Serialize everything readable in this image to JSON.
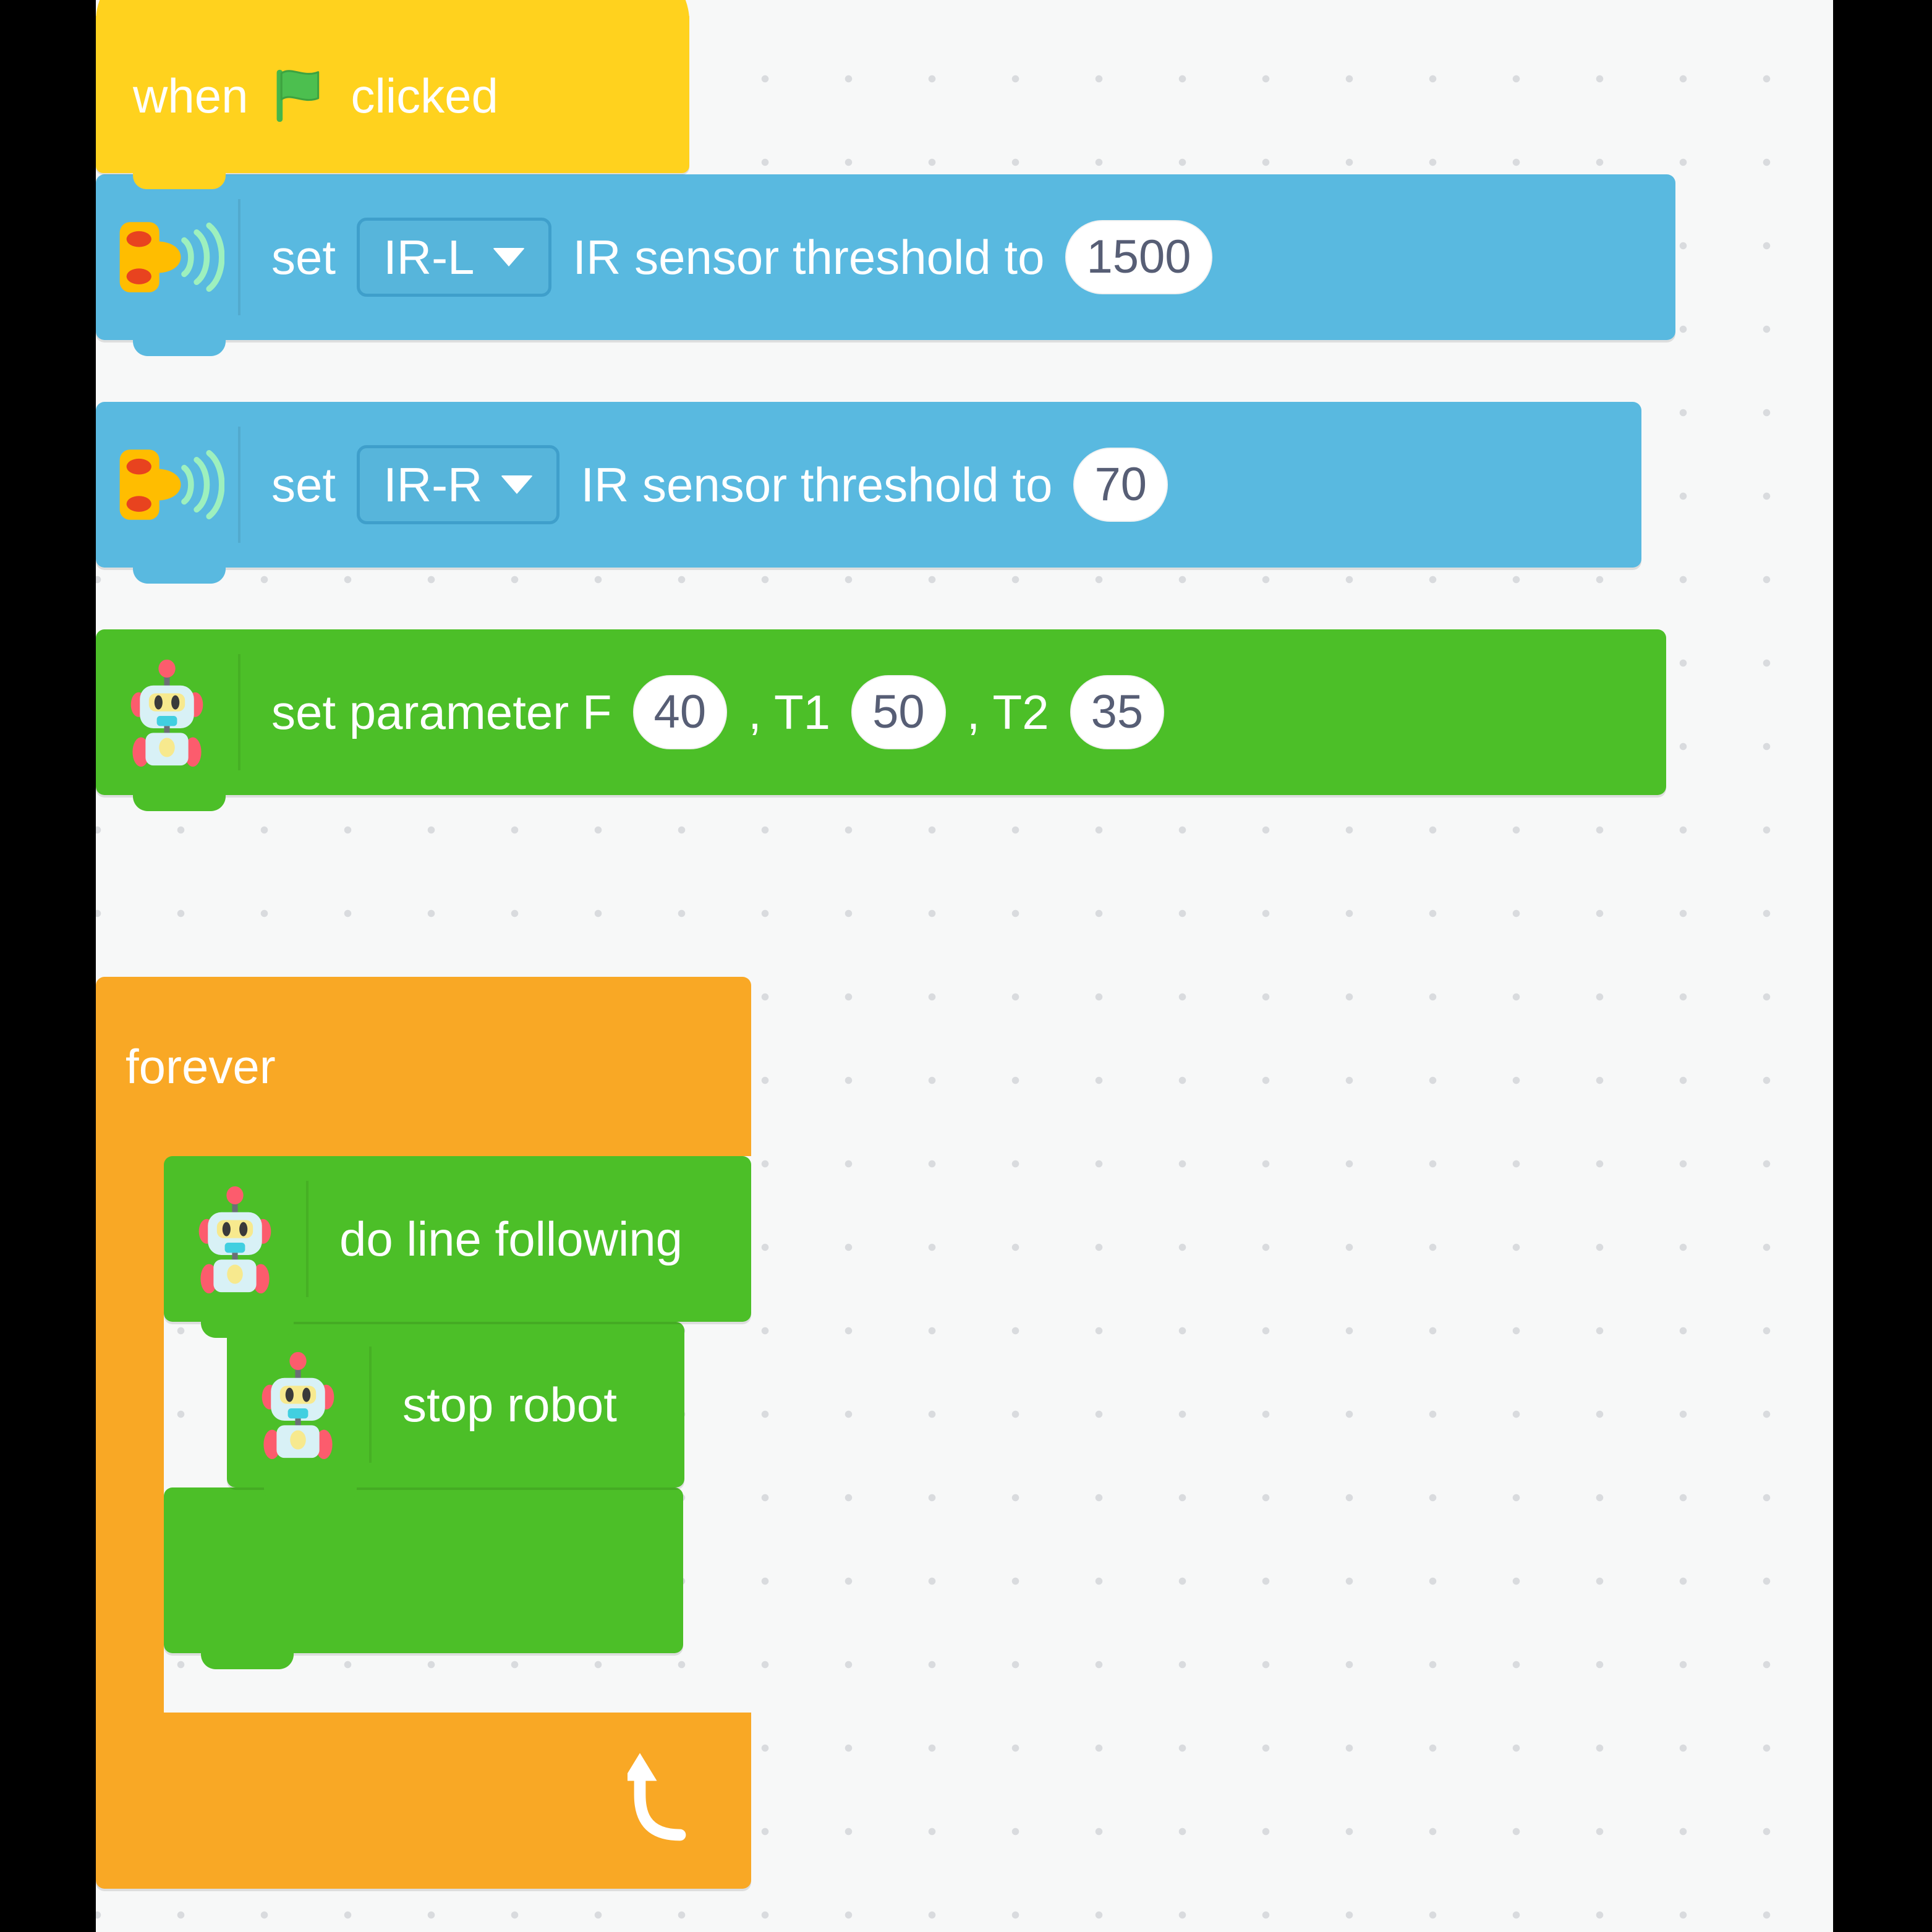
{
  "canvas": {
    "background_color": "#f7f8f8",
    "grid_dot_color": "#d9dbde"
  },
  "palette": {
    "event_yellow": "#ffd21e",
    "sensor_blue": "#59b9e0",
    "robot_green": "#4cbf28",
    "control_orange": "#f9a825",
    "field_white": "#ffffff",
    "field_text": "#575e75",
    "block_text": "#ffffff"
  },
  "script": {
    "hat": {
      "text_before": "when",
      "text_after": "clicked",
      "icon": "green-flag-icon"
    },
    "blocks": [
      {
        "id": "set-ir-l-threshold",
        "category": "sensor",
        "icon": "ir-sensor-icon",
        "label_1": "set",
        "dropdown_value": "IR-L",
        "dropdown_options": [
          "IR-L",
          "IR-R"
        ],
        "label_2": "IR sensor threshold to",
        "value": "1500"
      },
      {
        "id": "set-ir-r-threshold",
        "category": "sensor",
        "icon": "ir-sensor-icon",
        "label_1": "set",
        "dropdown_value": "IR-R",
        "dropdown_options": [
          "IR-L",
          "IR-R"
        ],
        "label_2": "IR sensor threshold to",
        "value": "70"
      },
      {
        "id": "set-parameter",
        "category": "robot",
        "icon": "robot-icon",
        "label_f": "set parameter F",
        "value_f": "40",
        "label_t1": ", T1",
        "value_t1": "50",
        "label_t2": ", T2",
        "value_t2": "35"
      }
    ],
    "forever": {
      "label": "forever",
      "loop_icon": "loop-arrow-icon",
      "children": [
        {
          "id": "do-line-following",
          "category": "robot",
          "icon": "robot-icon",
          "label": "do line following"
        },
        {
          "id": "stop-robot",
          "category": "robot",
          "icon": "robot-icon",
          "label": "stop robot"
        },
        {
          "id": "empty-robot-block",
          "category": "robot",
          "icon": "",
          "label": ""
        }
      ]
    }
  }
}
